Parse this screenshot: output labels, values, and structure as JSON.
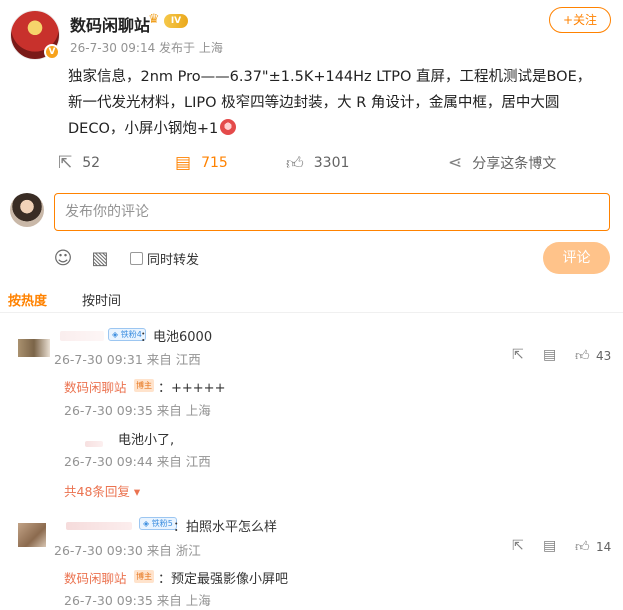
{
  "post": {
    "author": "数码闲聊站",
    "verify_badge": "V",
    "level_badge": "IV",
    "follow_label": "+关注",
    "meta": "26-7-30 09:14  发布于 上海",
    "text_line1": "独家信息，2nm Pro——6.37\"±1.5K+144Hz LTPO 直屏，工程机测试是BOE，",
    "text_line2": "新一代发光材料，LIPO 极窄四等边封装，大 R 角设计，金属中框，居中大圆",
    "text_line3": "DECO，小屏小钢炮+1"
  },
  "actions": {
    "repost_count": "52",
    "comment_count": "715",
    "like_count": "3301",
    "share_label": "分享这条博文"
  },
  "composer": {
    "placeholder": "发布你的评论",
    "repost_checkbox_label": "同时转发",
    "submit_label": "评论"
  },
  "sort": {
    "hot": "按热度",
    "time": "按时间"
  },
  "comments": [
    {
      "badge": "铁粉4",
      "text": "：电池6000",
      "meta": "26-7-30 09:31 来自 江西",
      "like_count": "43",
      "replies": [
        {
          "name": "数码闲聊站",
          "badge": "博主",
          "text": "：+++++",
          "meta": "26-7-30 09:35 来自 上海"
        },
        {
          "name": "",
          "text": "电池小了,",
          "meta": "26-7-30 09:44 来自 江西"
        }
      ],
      "more_replies": "共48条回复"
    },
    {
      "badge": "铁粉5",
      "text": "：拍照水平怎么样",
      "meta": "26-7-30 09:30 来自 浙江",
      "like_count": "14",
      "replies": [
        {
          "name": "数码闲聊站",
          "badge": "博主",
          "text": "：预定最强影像小屏吧",
          "meta": "26-7-30 09:35 来自 上海"
        }
      ]
    }
  ],
  "icons": [
    "repost-icon",
    "comment-icon",
    "like-icon",
    "share-icon",
    "emoji-icon",
    "image-icon",
    "crown-icon",
    "reply-icon",
    "comment-reply-icon",
    "thumb-icon"
  ],
  "colors": {
    "accent": "#ff8200",
    "reply_name": "#eb7350",
    "meta": "#939393"
  }
}
